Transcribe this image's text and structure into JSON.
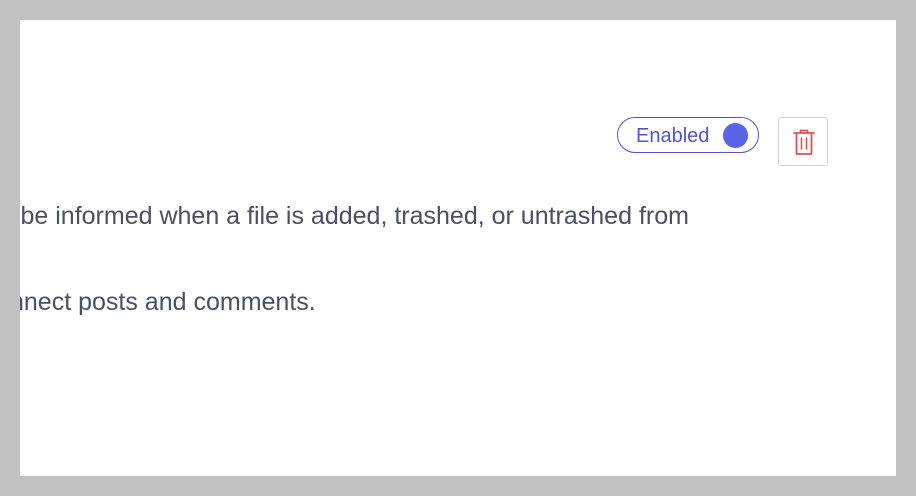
{
  "integration": {
    "status_label": "Enabled",
    "enabled": true,
    "accent_color": "#5b63e6",
    "delete_color": "#e05252"
  },
  "delete_button": {
    "icon": "trash-icon"
  },
  "description": {
    "line1": "l be informed when a file is added, trashed, or untrashed from",
    "line2": "nnect posts and comments."
  }
}
